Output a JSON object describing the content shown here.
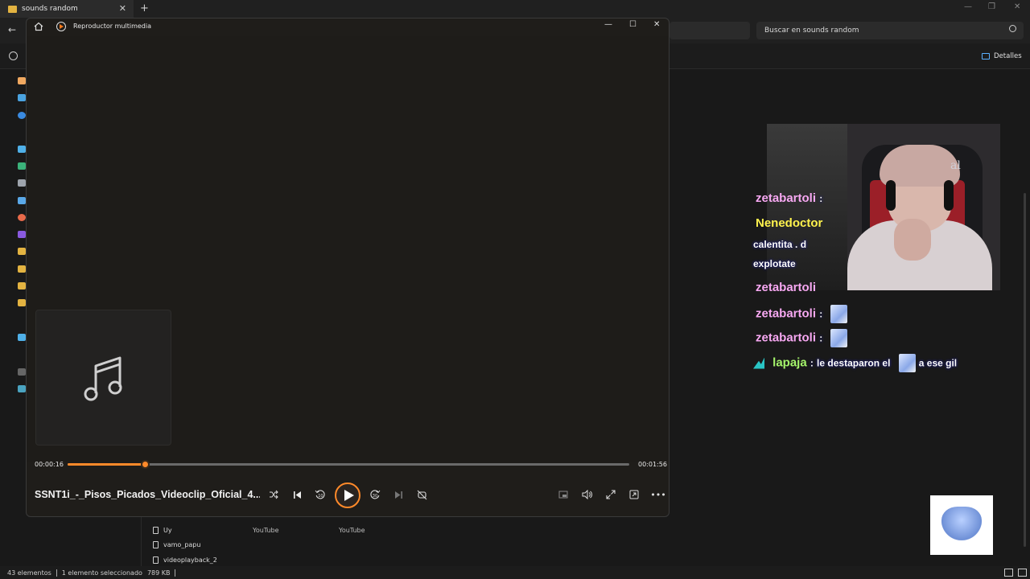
{
  "explorer": {
    "tab_title": "sounds random",
    "search_placeholder": "Buscar en sounds random",
    "details_label": "Detalles",
    "files": [
      {
        "name": "Uy",
        "col2": "YouTube",
        "col3": "YouTube"
      },
      {
        "name": "vamo_papu",
        "col2": "",
        "col3": ""
      },
      {
        "name": "videoplayback_2",
        "col2": "",
        "col3": ""
      }
    ],
    "status": {
      "count": "43 elementos",
      "selection": "1 elemento seleccionado",
      "size": "789 KB"
    }
  },
  "player": {
    "app_title": "Reproductor multimedia",
    "track_title": "SSNT1i_-_Pisos_Picados_Videoclip_Oficial_4...",
    "time_current": "00:00:16",
    "time_total": "00:01:56",
    "progress_fraction": 0.138,
    "accent_color": "#ff8a2a",
    "controls": [
      "shuffle-icon",
      "previous-icon",
      "rewind-10-icon",
      "play-icon",
      "forward-30-icon",
      "next-icon",
      "repeat-off-icon",
      "miniplayer-icon",
      "volume-icon",
      "fullscreen-icon",
      "cast-icon",
      "more-icon"
    ],
    "rewind_label": "10",
    "forward_label": "30"
  },
  "overlay": {
    "cam_logo": "al",
    "chat": [
      {
        "user": "zetabartoli",
        "sep": ":",
        "color": "pink"
      },
      {
        "user": "Nenedoctor",
        "sep": "",
        "color": "yellow"
      },
      {
        "user": "",
        "text": "calentita . d",
        "color": "white"
      },
      {
        "user": "",
        "text": "explotate",
        "color": "white"
      },
      {
        "user": "zetabartoli",
        "sep": ":",
        "color": "pink"
      },
      {
        "user": "zetabartoli",
        "sep": ":",
        "color": "pink"
      },
      {
        "user": "zetabartoli",
        "sep": ":",
        "color": "pink"
      },
      {
        "user": "lapaja",
        "sep": ":",
        "text": "le destaparon el",
        "text2": "a ese gil",
        "color": "green"
      }
    ]
  }
}
